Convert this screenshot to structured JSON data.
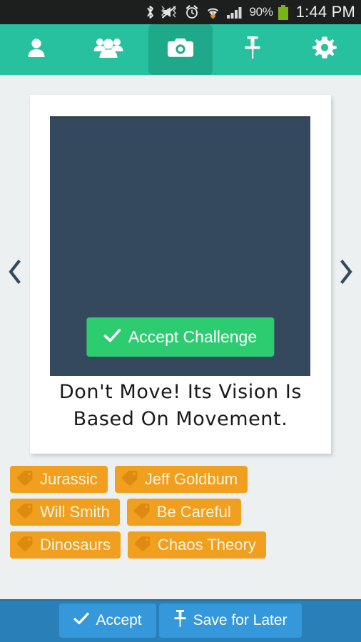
{
  "statusbar": {
    "icons": [
      "bluetooth-icon",
      "mute-vibrate-icon",
      "alarm-icon",
      "wifi-download-icon",
      "signal-icon"
    ],
    "battery_percent": "90%",
    "battery_icon": "battery-icon",
    "time": "1:44 PM"
  },
  "navbar": {
    "items": [
      {
        "name": "person-icon",
        "label": "Profile",
        "active": false
      },
      {
        "name": "group-icon",
        "label": "Friends",
        "active": false
      },
      {
        "name": "camera-icon",
        "label": "Camera",
        "active": true
      },
      {
        "name": "pin-icon",
        "label": "Pinned",
        "active": false
      },
      {
        "name": "gear-icon",
        "label": "Settings",
        "active": false
      }
    ]
  },
  "carousel": {
    "prev_icon": "chevron-left-icon",
    "next_icon": "chevron-right-icon"
  },
  "card": {
    "photo_placeholder_color": "#34495e",
    "accept_challenge_label": "Accept Challenge",
    "accept_challenge_icon": "check-icon",
    "caption": "Don't Move! Its Vision Is Based On Movement."
  },
  "tags": [
    {
      "label": "Jurassic"
    },
    {
      "label": "Jeff Goldbum"
    },
    {
      "label": "Will Smith"
    },
    {
      "label": "Be Careful"
    },
    {
      "label": "Dinosaurs"
    },
    {
      "label": "Chaos Theory"
    }
  ],
  "actionbar": {
    "accept_label": "Accept",
    "accept_icon": "check-icon",
    "save_label": "Save for Later",
    "save_icon": "pin-icon"
  },
  "colors": {
    "navbar_green": "#27c1a0",
    "navbar_active_green": "#1fa98b",
    "accent_green": "#2ecc71",
    "tag_orange": "#f0a01e",
    "action_blue": "#2980b9",
    "action_button_blue": "#3498db",
    "page_background": "#ecf0f1",
    "photo_navy": "#34495e"
  }
}
